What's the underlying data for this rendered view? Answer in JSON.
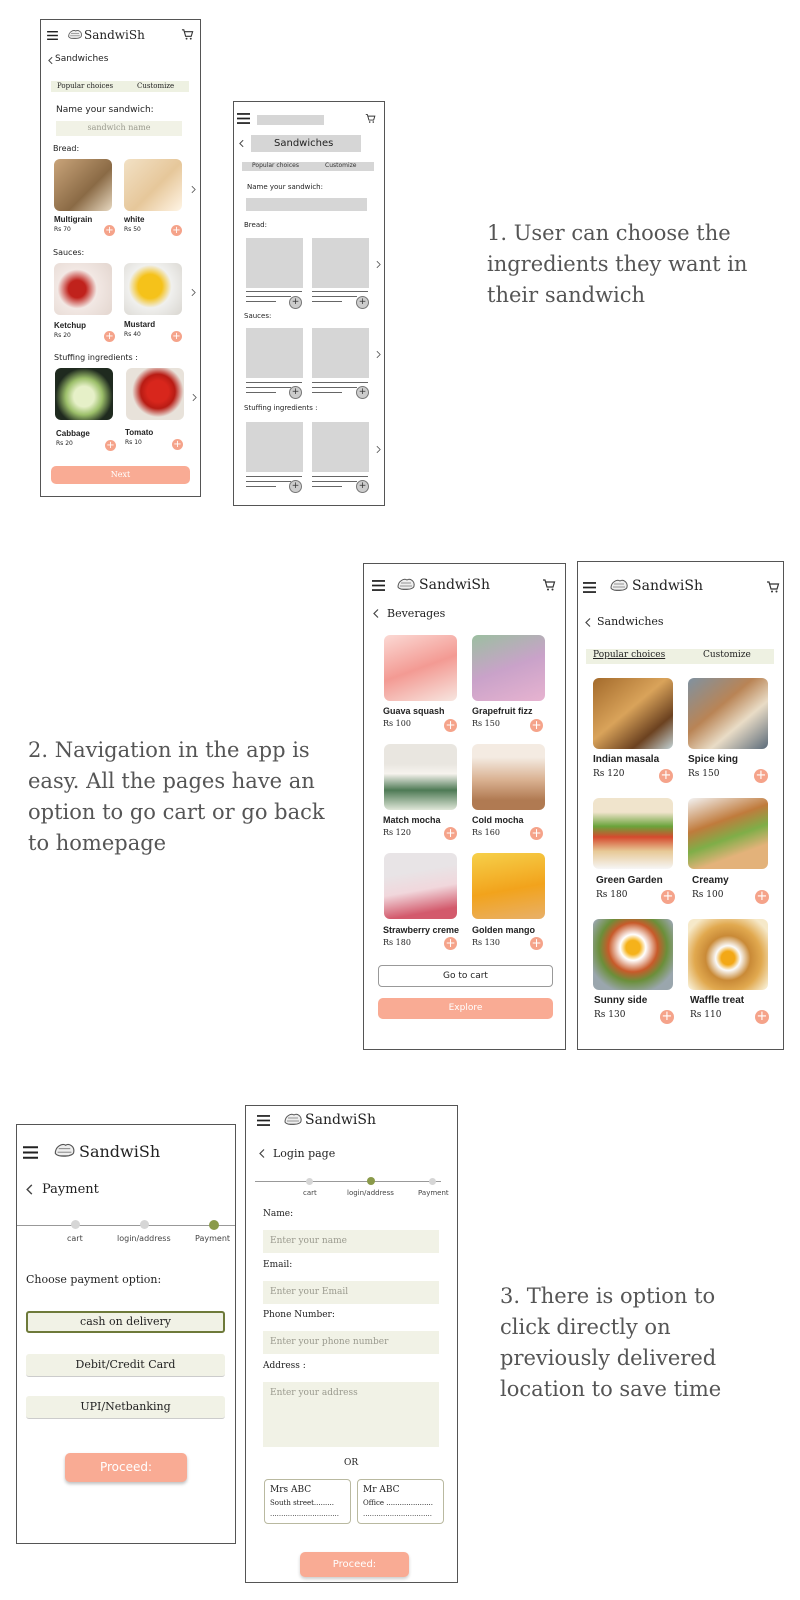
{
  "brand": {
    "name": "SandwiSh"
  },
  "screen1": {
    "title": "Sandwiches",
    "tabs": [
      "Popular choices",
      "Customize"
    ],
    "name_label": "Name your sandwich:",
    "name_placeholder": "sandwich name",
    "bread_label": "Bread:",
    "bread_items": [
      {
        "name": "Multigrain",
        "price": "Rs 70"
      },
      {
        "name": "white",
        "price": "Rs 50"
      }
    ],
    "sauces_label": "Sauces:",
    "sauce_items": [
      {
        "name": "Ketchup",
        "price": "Rs 20"
      },
      {
        "name": "Mustard",
        "price": "Rs 40"
      }
    ],
    "stuffing_label": "Stuffing ingredients :",
    "stuffing_items": [
      {
        "name": "Cabbage",
        "price": "Rs 20"
      },
      {
        "name": "Tomato",
        "price": "Rs 10"
      }
    ],
    "next_button": "Next"
  },
  "wireframe": {
    "title": "Sandwiches",
    "tabs": [
      "Popular choices",
      "Customize"
    ],
    "name_label": "Name your sandwich:",
    "bread_label": "Bread:",
    "sauces_label": "Sauces:",
    "stuffing_label": "Stuffing ingredients :"
  },
  "notes": {
    "note1": "1. User can choose the ingredients they want in their sandwich",
    "note2": "2. Navigation in the app is easy. All the pages have an option to go cart or go back to homepage",
    "note3": "3. There is option to click directly on previously delivered location to save time"
  },
  "beverages": {
    "title": "Beverages",
    "items": [
      {
        "name": "Guava squash",
        "price": "Rs 100"
      },
      {
        "name": "Grapefruit fizz",
        "price": "Rs 150"
      },
      {
        "name": "Match mocha",
        "price": "Rs 120"
      },
      {
        "name": "Cold mocha",
        "price": "Rs 160"
      },
      {
        "name": "Strawberry creme",
        "price": "Rs 180"
      },
      {
        "name": "Golden mango",
        "price": "Rs 130"
      }
    ],
    "cart_button": "Go to cart",
    "explore_button": "Explore"
  },
  "sandwiches": {
    "title": "Sandwiches",
    "tabs": [
      "Popular choices",
      "Customize"
    ],
    "items": [
      {
        "name": "Indian masala",
        "price": "Rs 120"
      },
      {
        "name": "Spice king",
        "price": "Rs 150"
      },
      {
        "name": "Green Garden",
        "price": "Rs 180"
      },
      {
        "name": "Creamy",
        "price": "Rs 100"
      },
      {
        "name": "Sunny side",
        "price": "Rs 130"
      },
      {
        "name": "Waffle treat",
        "price": "Rs 110"
      }
    ]
  },
  "payment": {
    "title": "Payment",
    "steps": [
      "cart",
      "login/address",
      "Payment"
    ],
    "choose_label": "Choose payment option:",
    "options": [
      "cash on delivery",
      "Debit/Credit Card",
      "UPI/Netbanking"
    ],
    "proceed_button": "Proceed:"
  },
  "login": {
    "title": "Login page",
    "steps": [
      "cart",
      "login/address",
      "Payment"
    ],
    "name_label": "Name:",
    "name_placeholder": "Enter your name",
    "email_label": "Email:",
    "email_placeholder": "Enter your Email",
    "phone_label": "Phone Number:",
    "phone_placeholder": "Enter your phone number",
    "address_label": "Address :",
    "address_placeholder": "Enter your address",
    "or_label": "OR",
    "saved_addresses": [
      {
        "name": "Mrs ABC",
        "line": "South street.........",
        "dots": "..............................."
      },
      {
        "name": "Mr ABC",
        "line": "Office .....................",
        "dots": "..............................."
      }
    ],
    "proceed_button": "Proceed:"
  },
  "colors": {
    "accent": "#f9ab94",
    "olive": "#8a9a4a",
    "tab_bg": "#eef1e2"
  }
}
